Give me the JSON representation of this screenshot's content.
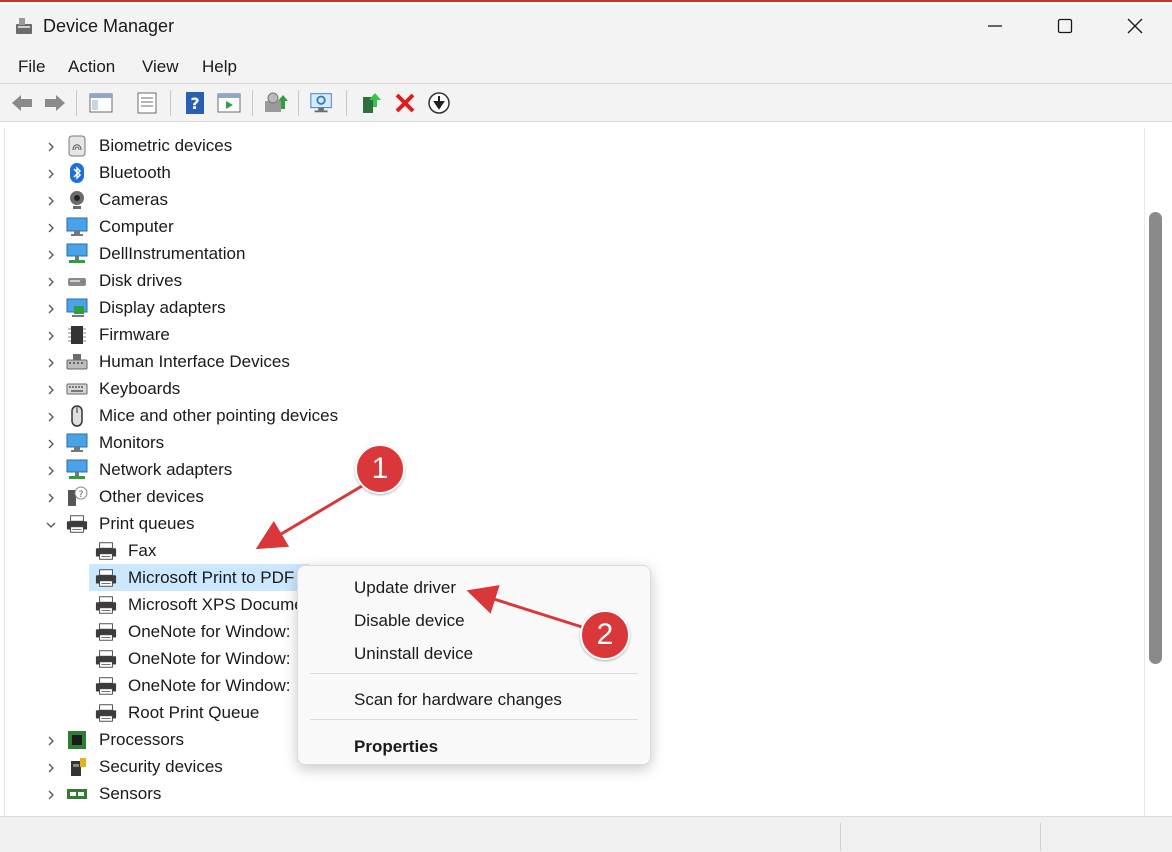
{
  "window": {
    "title": "Device Manager"
  },
  "menu": [
    "File",
    "Action",
    "View",
    "Help"
  ],
  "toolbar": {
    "icons": [
      "back-arrow-icon",
      "forward-arrow-icon",
      "show-hide-console-tree-icon",
      "properties-icon",
      "help-icon",
      "action-pane-icon",
      "update-driver-icon",
      "scan-hardware-icon",
      "enable-device-icon",
      "uninstall-device-icon",
      "disable-device-icon"
    ]
  },
  "tree": {
    "top_items": [
      {
        "label": "Biometric devices",
        "icon": "fingerprint-icon"
      },
      {
        "label": "Bluetooth",
        "icon": "bluetooth-icon"
      },
      {
        "label": "Cameras",
        "icon": "webcam-icon"
      },
      {
        "label": "Computer",
        "icon": "monitor-icon"
      },
      {
        "label": "DellInstrumentation",
        "icon": "network-monitor-icon"
      },
      {
        "label": "Disk drives",
        "icon": "disk-drive-icon"
      },
      {
        "label": "Display adapters",
        "icon": "display-adapter-icon"
      },
      {
        "label": "Firmware",
        "icon": "chip-icon"
      },
      {
        "label": "Human Interface Devices",
        "icon": "hid-icon"
      },
      {
        "label": "Keyboards",
        "icon": "keyboard-icon"
      },
      {
        "label": "Mice and other pointing devices",
        "icon": "mouse-icon"
      },
      {
        "label": "Monitors",
        "icon": "monitor-icon"
      },
      {
        "label": "Network adapters",
        "icon": "network-adapter-icon"
      },
      {
        "label": "Other devices",
        "icon": "unknown-device-icon"
      },
      {
        "label": "Print queues",
        "icon": "printer-icon"
      }
    ],
    "print_queue_children": [
      {
        "label": "Fax"
      },
      {
        "label": "Microsoft Print to PDF"
      },
      {
        "label": "Microsoft XPS Docume"
      },
      {
        "label": "OneNote for Window:"
      },
      {
        "label": "OneNote for Window:"
      },
      {
        "label": "OneNote for Window:"
      },
      {
        "label": "Root Print Queue"
      }
    ],
    "bottom_items": [
      {
        "label": "Processors",
        "icon": "processor-icon"
      },
      {
        "label": "Security devices",
        "icon": "security-device-icon"
      },
      {
        "label": "Sensors",
        "icon": "sensor-icon"
      }
    ]
  },
  "context_menu": {
    "update_driver": "Update driver",
    "disable_device": "Disable device",
    "uninstall_device": "Uninstall device",
    "scan": "Scan for hardware changes",
    "properties": "Properties"
  },
  "annotations": {
    "step1": "1",
    "step2": "2"
  },
  "colors": {
    "accent_red": "#d9373a",
    "selection": "#cce8ff",
    "titlebar_border": "#c0392b"
  }
}
